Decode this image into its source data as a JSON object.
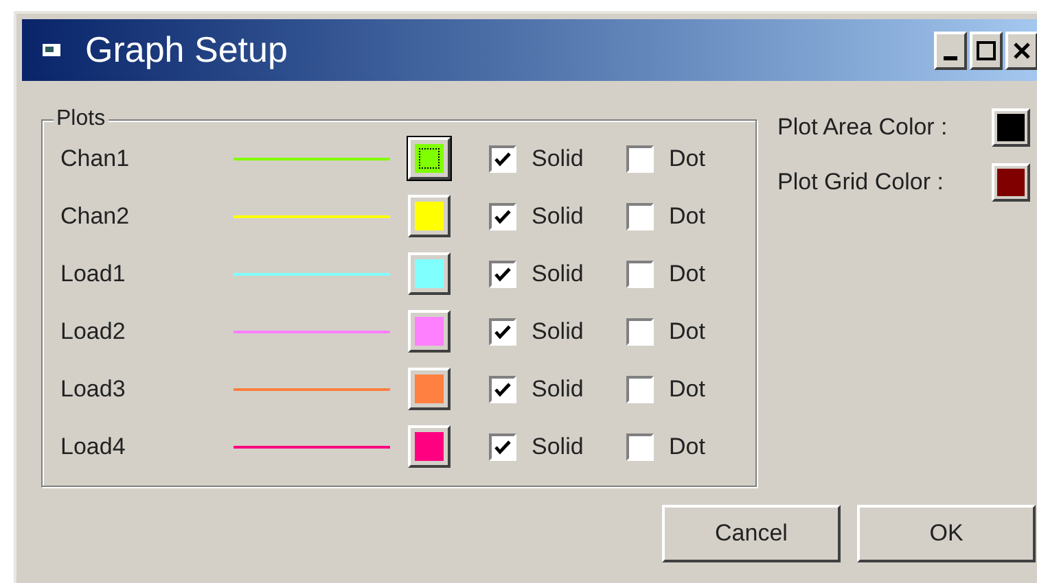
{
  "window": {
    "title": "Graph Setup"
  },
  "plots_group": {
    "label": "Plots",
    "rows": [
      {
        "name": "Chan1",
        "color": "#80ff00",
        "focused": true,
        "solid": true,
        "dot": false,
        "solid_label": "Solid",
        "dot_label": "Dot"
      },
      {
        "name": "Chan2",
        "color": "#ffff00",
        "focused": false,
        "solid": true,
        "dot": false,
        "solid_label": "Solid",
        "dot_label": "Dot"
      },
      {
        "name": "Load1",
        "color": "#80ffff",
        "focused": false,
        "solid": true,
        "dot": false,
        "solid_label": "Solid",
        "dot_label": "Dot"
      },
      {
        "name": "Load2",
        "color": "#ff80ff",
        "focused": false,
        "solid": true,
        "dot": false,
        "solid_label": "Solid",
        "dot_label": "Dot"
      },
      {
        "name": "Load3",
        "color": "#ff8040",
        "focused": false,
        "solid": true,
        "dot": false,
        "solid_label": "Solid",
        "dot_label": "Dot"
      },
      {
        "name": "Load4",
        "color": "#ff0080",
        "focused": false,
        "solid": true,
        "dot": false,
        "solid_label": "Solid",
        "dot_label": "Dot"
      }
    ]
  },
  "color_settings": [
    {
      "label": "Plot Area Color :",
      "color": "#000000"
    },
    {
      "label": "Plot Grid Color :",
      "color": "#800000"
    }
  ],
  "buttons": [
    "Cancel",
    "OK"
  ]
}
